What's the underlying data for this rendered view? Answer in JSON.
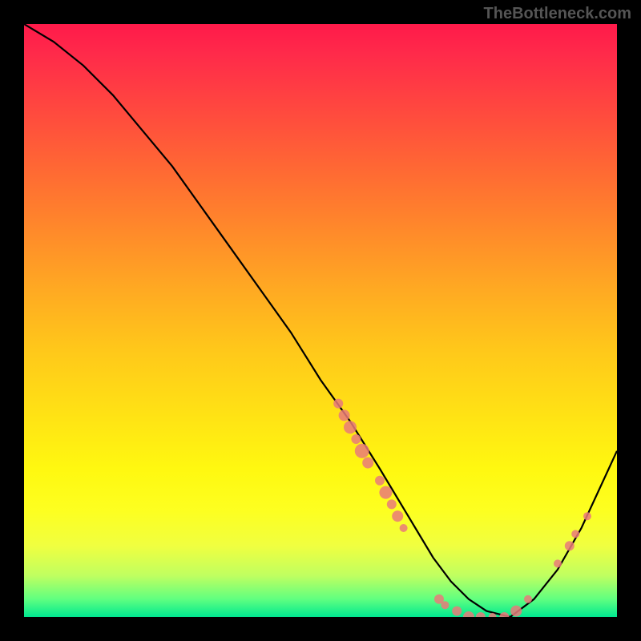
{
  "watermark": "TheBottleneck.com",
  "chart_data": {
    "type": "line",
    "title": "",
    "xlabel": "",
    "ylabel": "",
    "xlim": [
      0,
      100
    ],
    "ylim": [
      0,
      100
    ],
    "background_gradient": {
      "top": "#ff1a4a",
      "bottom": "#00e890",
      "description": "red-to-yellow-to-green vertical gradient"
    },
    "series": [
      {
        "name": "bottleneck-curve",
        "color": "#000000",
        "x": [
          0,
          5,
          10,
          15,
          20,
          25,
          30,
          35,
          40,
          45,
          50,
          55,
          60,
          63,
          66,
          69,
          72,
          75,
          78,
          82,
          86,
          90,
          94,
          100
        ],
        "y": [
          100,
          97,
          93,
          88,
          82,
          76,
          69,
          62,
          55,
          48,
          40,
          33,
          25,
          20,
          15,
          10,
          6,
          3,
          1,
          0,
          3,
          8,
          15,
          28
        ]
      }
    ],
    "scatter_points": {
      "name": "data-markers",
      "color": "#e97a7a",
      "radius_range": [
        4,
        9
      ],
      "points": [
        {
          "x": 53,
          "y": 36,
          "r": 6
        },
        {
          "x": 54,
          "y": 34,
          "r": 7
        },
        {
          "x": 55,
          "y": 32,
          "r": 8
        },
        {
          "x": 56,
          "y": 30,
          "r": 6
        },
        {
          "x": 57,
          "y": 28,
          "r": 9
        },
        {
          "x": 58,
          "y": 26,
          "r": 7
        },
        {
          "x": 60,
          "y": 23,
          "r": 6
        },
        {
          "x": 61,
          "y": 21,
          "r": 8
        },
        {
          "x": 62,
          "y": 19,
          "r": 6
        },
        {
          "x": 63,
          "y": 17,
          "r": 7
        },
        {
          "x": 64,
          "y": 15,
          "r": 5
        },
        {
          "x": 70,
          "y": 3,
          "r": 6
        },
        {
          "x": 71,
          "y": 2,
          "r": 5
        },
        {
          "x": 73,
          "y": 1,
          "r": 6
        },
        {
          "x": 75,
          "y": 0,
          "r": 7
        },
        {
          "x": 77,
          "y": 0,
          "r": 6
        },
        {
          "x": 79,
          "y": 0,
          "r": 5
        },
        {
          "x": 81,
          "y": 0,
          "r": 6
        },
        {
          "x": 83,
          "y": 1,
          "r": 7
        },
        {
          "x": 85,
          "y": 3,
          "r": 5
        },
        {
          "x": 90,
          "y": 9,
          "r": 5
        },
        {
          "x": 92,
          "y": 12,
          "r": 6
        },
        {
          "x": 93,
          "y": 14,
          "r": 5
        },
        {
          "x": 95,
          "y": 17,
          "r": 5
        }
      ]
    }
  }
}
